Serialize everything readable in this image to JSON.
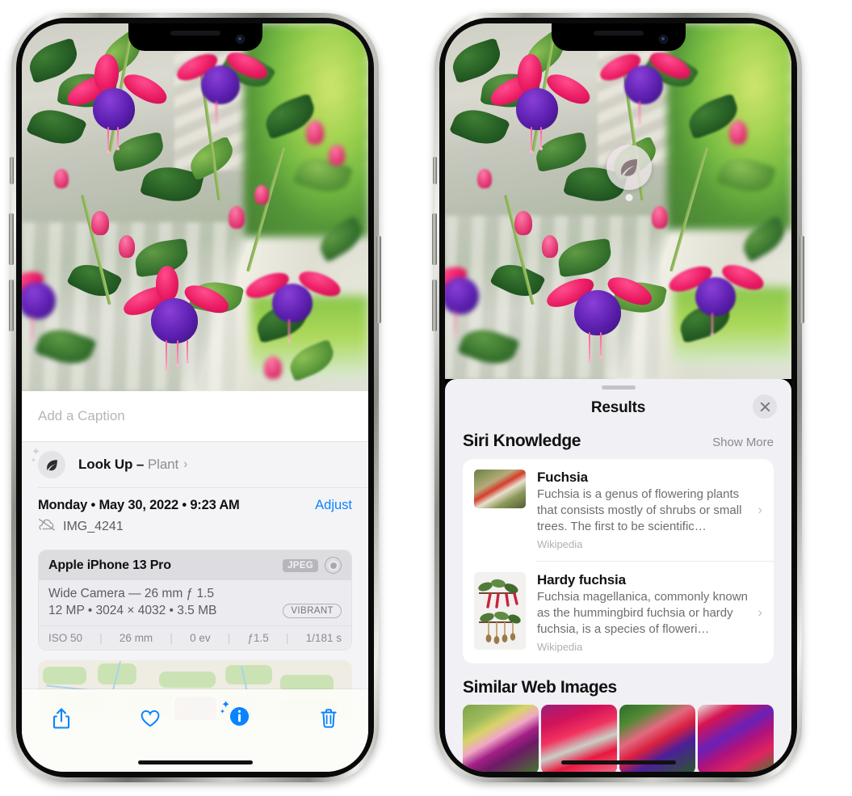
{
  "left_phone": {
    "caption_placeholder": "Add a Caption",
    "lookup": {
      "icon": "leaf-icon",
      "label": "Look Up – ",
      "subject": "Plant",
      "chevron": "›"
    },
    "metadata": {
      "date": "Monday • May 30, 2022 • 9:23 AM",
      "adjust_label": "Adjust",
      "cloud_icon": "cloud-slash-icon",
      "filename": "IMG_4241"
    },
    "camera_card": {
      "device": "Apple iPhone 13 Pro",
      "format_badge": "JPEG",
      "lens_icon": "aperture-icon",
      "lens_line": "Wide Camera — 26 mm ƒ 1.5",
      "size_line": "12 MP • 3024 × 4032 • 3.5 MB",
      "style_badge": "VIBRANT",
      "exif": [
        "ISO 50",
        "26 mm",
        "0 ev",
        "ƒ1.5",
        "1/181 s"
      ]
    },
    "toolbar": [
      {
        "name": "share-button",
        "icon": "share-icon"
      },
      {
        "name": "favorite-button",
        "icon": "heart-icon"
      },
      {
        "name": "info-button",
        "icon": "info-sparkle-icon"
      },
      {
        "name": "delete-button",
        "icon": "trash-icon"
      }
    ]
  },
  "right_phone": {
    "photo_badge": {
      "icon": "leaf-icon"
    },
    "sheet": {
      "title": "Results",
      "close_icon": "close-icon"
    },
    "siri_knowledge": {
      "section_title": "Siri Knowledge",
      "show_more": "Show More",
      "items": [
        {
          "title": "Fuchsia",
          "description": "Fuchsia is a genus of flowering plants that consists mostly of shrubs or small trees. The first to be scientific…",
          "source": "Wikipedia",
          "chevron": "›"
        },
        {
          "title": "Hardy fuchsia",
          "description": "Fuchsia magellanica, commonly known as the hummingbird fuchsia or hardy fuchsia, is a species of floweri…",
          "source": "Wikipedia",
          "chevron": "›"
        }
      ]
    },
    "similar_web_images": {
      "section_title": "Similar Web Images",
      "count": 4
    }
  },
  "colors": {
    "accent_blue": "#0a84ff",
    "sheet_grey": "#f1f0f5",
    "text_primary": "#111111",
    "text_secondary": "#6d6d73",
    "badge_grey": "#b6b6bc"
  }
}
